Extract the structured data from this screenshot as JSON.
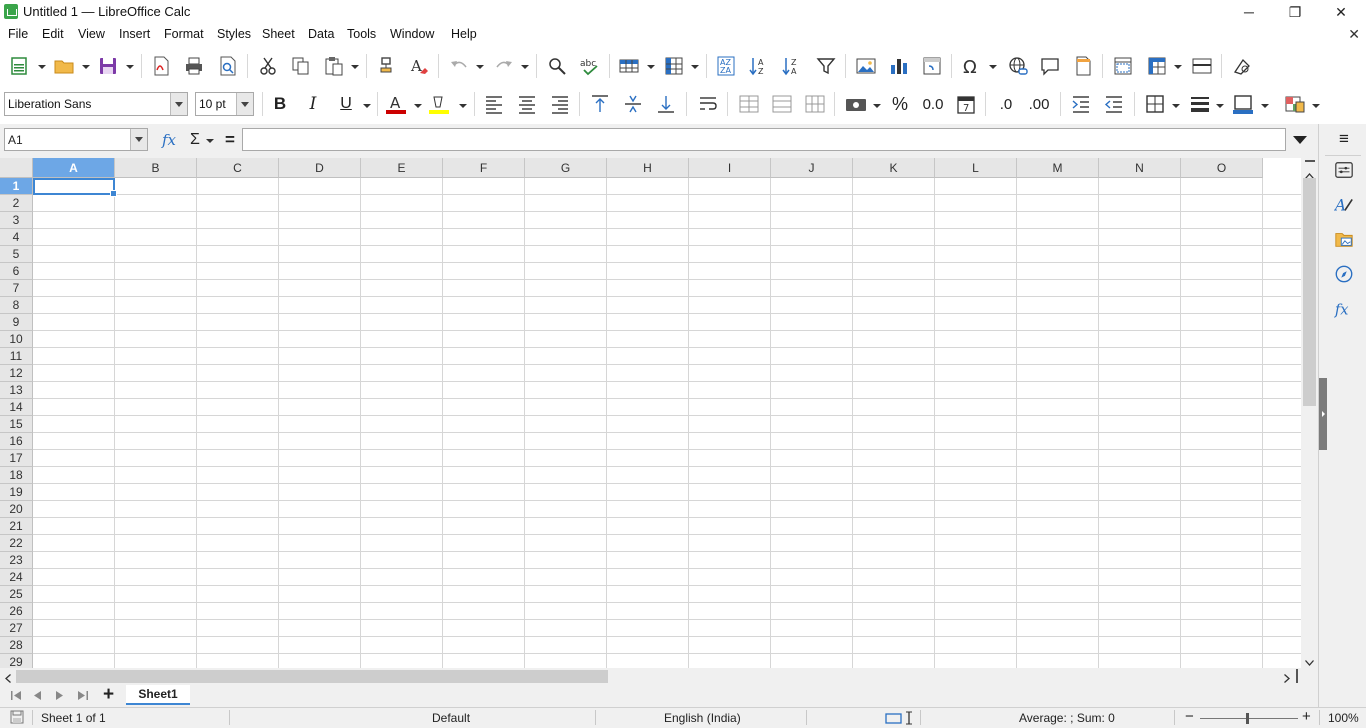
{
  "window": {
    "title": "Untitled 1 — LibreOffice Calc",
    "minimize": "─",
    "restore": "❐",
    "close": "✕"
  },
  "menu": [
    "File",
    "Edit",
    "View",
    "Insert",
    "Format",
    "Styles",
    "Sheet",
    "Data",
    "Tools",
    "Window",
    "Help"
  ],
  "close_document": "✕",
  "format_toolbar": {
    "font_name": "Liberation Sans",
    "font_size": "10 pt",
    "bold": "B",
    "italic": "I",
    "underline": "U",
    "font_color_glyph": "A",
    "percent": "%",
    "number_format": "0.0",
    "add_decimal": ".0",
    "remove_decimal": ".00",
    "font_color_swatch": "#cc0000",
    "highlight_swatch": "#ffff00",
    "border_color_swatch": "#2a6fc2"
  },
  "formula_bar": {
    "name_box": "A1",
    "fx": "fx",
    "sigma": "Σ",
    "equals": "=",
    "formula": ""
  },
  "grid": {
    "columns": [
      "A",
      "B",
      "C",
      "D",
      "E",
      "F",
      "G",
      "H",
      "I",
      "J",
      "K",
      "L",
      "M",
      "N",
      "O"
    ],
    "rows": [
      "1",
      "2",
      "3",
      "4",
      "5",
      "6",
      "7",
      "8",
      "9",
      "10",
      "11",
      "12",
      "13",
      "14",
      "15",
      "16",
      "17",
      "18",
      "19",
      "20",
      "21",
      "22",
      "23",
      "24",
      "25",
      "26",
      "27",
      "28",
      "29"
    ],
    "selected_cell": "A1"
  },
  "sheet_tabs": {
    "add": "+",
    "tabs": [
      "Sheet1"
    ]
  },
  "status_bar": {
    "sheet": "Sheet 1 of 1",
    "page_style": "Default",
    "language": "English (India)",
    "sum": "Average: ; Sum: 0",
    "zoom_out": "−",
    "zoom_in": "+",
    "zoom": "100%"
  },
  "sidebar": {
    "menu_glyph": "≡"
  },
  "colors": {
    "accent": "#3d86d3",
    "selected_header": "#6da7e6",
    "app_icon": "#3aa54a"
  }
}
